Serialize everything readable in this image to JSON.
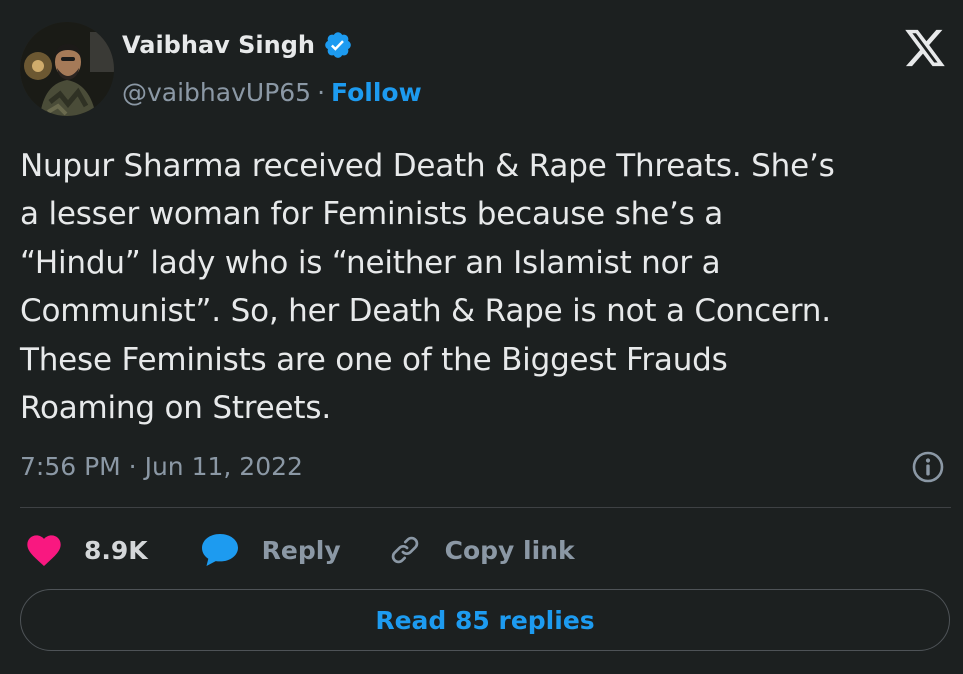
{
  "author": {
    "name": "Vaibhav Singh",
    "handle": "@vaibhavUP65",
    "separator": "·",
    "follow_label": "Follow",
    "verified": true
  },
  "tweet": {
    "lines": [
      "Nupur Sharma received Death & Rape Threats. She’s",
      "a lesser woman for Feminists because she’s a",
      "“Hindu” lady who is “neither an Islamist nor a",
      "Communist”. So, her Death & Rape is not a Concern.",
      "These Feminists are one of the Biggest Frauds",
      "Roaming on Streets."
    ],
    "timestamp": "7:56 PM · Jun 11, 2022"
  },
  "actions": {
    "like_count": "8.9K",
    "reply_label": "Reply",
    "copy_link_label": "Copy link"
  },
  "footer": {
    "read_replies_label": "Read 85 replies"
  },
  "icons": {
    "brand": "x-logo-icon",
    "verified": "verified-badge-icon",
    "info": "info-icon",
    "like": "heart-icon",
    "reply": "speech-bubble-icon",
    "copy": "link-icon"
  },
  "colors": {
    "background": "#1c2020",
    "accent": "#1d9bf0",
    "like": "#f91880",
    "text": "#e7e9ea",
    "muted": "#8b98a5"
  }
}
